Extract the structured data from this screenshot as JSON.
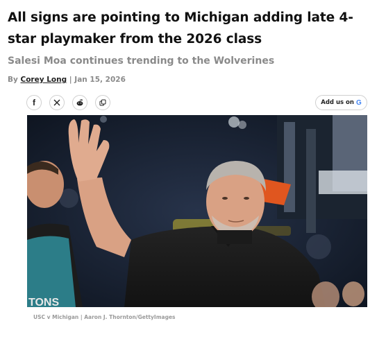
{
  "article": {
    "headline": "All signs are pointing to Michigan adding late 4-star playmaker from the 2026 class",
    "subheadline": "Salesi Moa continues trending to the Wolverines",
    "byline": {
      "prefix": "By",
      "author": "Corey Long",
      "separator": "|",
      "date": "Jan 15, 2026"
    }
  },
  "share": {
    "icons": [
      "facebook-icon",
      "x-icon",
      "reddit-icon",
      "copy-link-icon"
    ],
    "facebook_label": "f"
  },
  "google_button": {
    "label": "Add us on",
    "logo": "G"
  },
  "hero_image": {
    "caption": "USC v Michigan | Aaron J. Thornton/GettyImages",
    "jersey_text": "TONS",
    "colors": {
      "background": "#0e1620",
      "shirt": "#1a1a1a",
      "skin": "#d9a184",
      "hair": "#b8b3ad",
      "teal_jersey": "#2c7d88",
      "hoop_orange": "#e0561f"
    }
  },
  "colors": {
    "headline": "#111111",
    "muted": "#8a8a8a",
    "google_blue": "#4285F4",
    "google_red": "#EA4335",
    "google_yellow": "#FBBC05",
    "google_green": "#34A853"
  }
}
